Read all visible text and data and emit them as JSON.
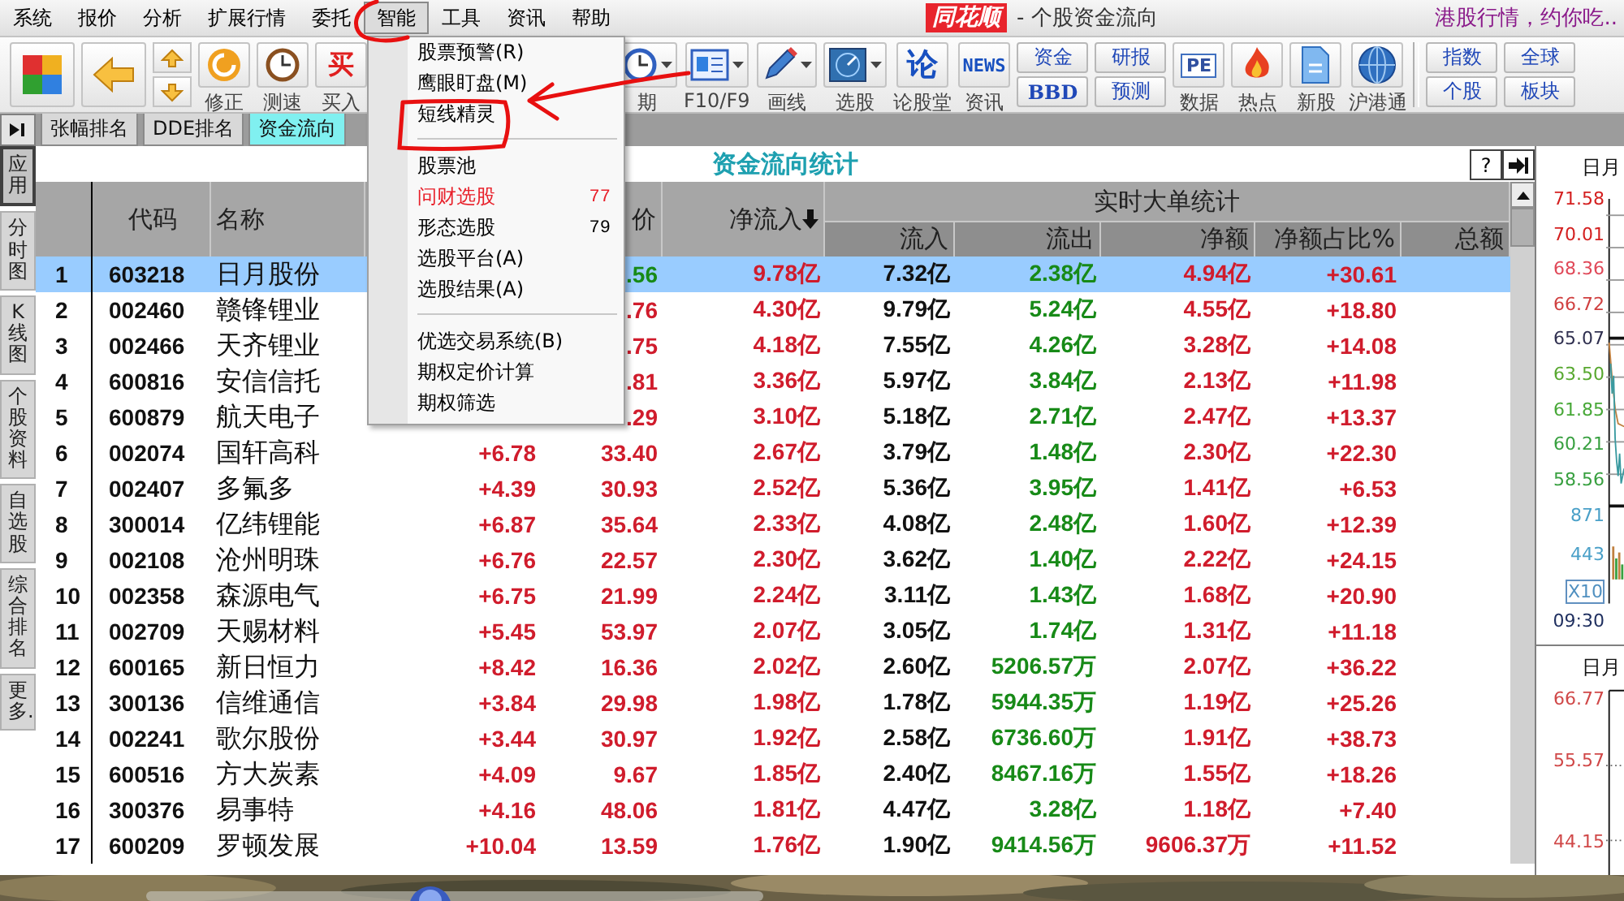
{
  "menu_bar": {
    "items": [
      {
        "label": "系统",
        "selected": false
      },
      {
        "label": "报价",
        "selected": false
      },
      {
        "label": "分析",
        "selected": false
      },
      {
        "label": "扩展行情",
        "selected": false
      },
      {
        "label": "委托",
        "selected": false
      },
      {
        "label": "智能",
        "selected": true
      },
      {
        "label": "工具",
        "selected": false
      },
      {
        "label": "资讯",
        "selected": false
      },
      {
        "label": "帮助",
        "selected": false
      }
    ],
    "logo": "同花顺",
    "title": "- 个股资金流向",
    "promo": "港股行情，约你吃.."
  },
  "toolbar": {
    "items": [
      {
        "kind": "large"
      },
      {
        "kind": "large"
      },
      {
        "kind": "updown"
      },
      {
        "kind": "icon",
        "label": "修正"
      },
      {
        "kind": "icon",
        "label": "测速"
      },
      {
        "kind": "icon",
        "label": "买入",
        "glyph": "买"
      },
      {
        "kind": "icon",
        "label": "期",
        "dropdown": true
      },
      {
        "kind": "icon",
        "label": "F10/F9",
        "dropdown": true
      },
      {
        "kind": "icon",
        "label": "画线",
        "dropdown": true
      },
      {
        "kind": "icon",
        "label": "选股",
        "dropdown": true
      },
      {
        "kind": "icon",
        "label": "论股堂",
        "glyph": "论"
      },
      {
        "kind": "icon",
        "label": "资讯",
        "glyph": "NEWS"
      },
      {
        "kind": "pair",
        "top": "资金",
        "bottom": "BBD"
      },
      {
        "kind": "pair",
        "top": "研报",
        "bottom": "预测"
      },
      {
        "kind": "icon",
        "label": "数据",
        "glyph": "PE"
      },
      {
        "kind": "icon",
        "label": "热点"
      },
      {
        "kind": "icon",
        "label": "新股"
      },
      {
        "kind": "icon",
        "label": "沪港通"
      },
      {
        "kind": "separator"
      },
      {
        "kind": "pair",
        "top": "指数",
        "bottom": "个股"
      },
      {
        "kind": "pair",
        "top": "全球",
        "bottom": "板块"
      }
    ]
  },
  "tabs": [
    {
      "label": "张幅排名",
      "selected": false
    },
    {
      "label": "DDE排名",
      "selected": false
    },
    {
      "label": "资金流向",
      "selected": true
    }
  ],
  "sidebar": {
    "items": [
      {
        "label": "应用",
        "selected": true
      },
      {
        "label": "分时图",
        "selected": false
      },
      {
        "label": "K线图",
        "selected": false
      },
      {
        "label": "个股资料",
        "selected": false
      },
      {
        "label": "自选股",
        "selected": false
      },
      {
        "label": "综合排名",
        "selected": false
      },
      {
        "label": "更多..",
        "selected": false
      }
    ]
  },
  "table": {
    "title": "资金流向统计",
    "help": "?",
    "columns": [
      {
        "label": "代码"
      },
      {
        "label": "名称"
      },
      {
        "label": "价"
      },
      {
        "label": "净流入",
        "sorted": true
      }
    ],
    "group": {
      "label": "实时大单统计",
      "columns": [
        "流入",
        "流出",
        "净额",
        "净额占比%",
        "总额"
      ]
    },
    "rows": [
      {
        "no": "1",
        "code": "603218",
        "name": "日月股份",
        "price": ".56",
        "price_down": true,
        "net_inflow": "9.78亿",
        "inflow": "7.32亿",
        "outflow": "2.38亿",
        "net_amount": "4.94亿",
        "net_ratio": "+30.61",
        "selected": true
      },
      {
        "no": "2",
        "code": "002460",
        "name": "赣锋锂业",
        "price": ".76",
        "price_down": false,
        "net_inflow": "4.30亿",
        "inflow": "9.79亿",
        "outflow": "5.24亿",
        "net_amount": "4.55亿",
        "net_ratio": "+18.80",
        "selected": false
      },
      {
        "no": "3",
        "code": "002466",
        "name": "天齐锂业",
        "price": ".75",
        "price_down": false,
        "net_inflow": "4.18亿",
        "inflow": "7.55亿",
        "outflow": "4.26亿",
        "net_amount": "3.28亿",
        "net_ratio": "+14.08",
        "selected": false
      },
      {
        "no": "4",
        "code": "600816",
        "name": "安信信托",
        "price": ".81",
        "price_down": false,
        "net_inflow": "3.36亿",
        "inflow": "5.97亿",
        "outflow": "3.84亿",
        "net_amount": "2.13亿",
        "net_ratio": "+11.98",
        "selected": false
      },
      {
        "no": "5",
        "code": "600879",
        "name": "航天电子",
        "price": ".29",
        "price_down": false,
        "net_inflow": "3.10亿",
        "inflow": "5.18亿",
        "outflow": "2.71亿",
        "net_amount": "2.47亿",
        "net_ratio": "+13.37",
        "selected": false
      },
      {
        "no": "6",
        "code": "002074",
        "name": "国轩高科",
        "change": "+6.78",
        "price": "33.40",
        "price_down": false,
        "net_inflow": "2.67亿",
        "inflow": "3.79亿",
        "outflow": "1.48亿",
        "net_amount": "2.30亿",
        "net_ratio": "+22.30",
        "selected": false
      },
      {
        "no": "7",
        "code": "002407",
        "name": "多氟多",
        "change": "+4.39",
        "price": "30.93",
        "price_down": false,
        "net_inflow": "2.52亿",
        "inflow": "5.36亿",
        "outflow": "3.95亿",
        "net_amount": "1.41亿",
        "net_ratio": "+6.53",
        "selected": false
      },
      {
        "no": "8",
        "code": "300014",
        "name": "亿纬锂能",
        "change": "+6.87",
        "price": "35.64",
        "price_down": false,
        "net_inflow": "2.33亿",
        "inflow": "4.08亿",
        "outflow": "2.48亿",
        "net_amount": "1.60亿",
        "net_ratio": "+12.39",
        "selected": false
      },
      {
        "no": "9",
        "code": "002108",
        "name": "沧州明珠",
        "change": "+6.76",
        "price": "22.57",
        "price_down": false,
        "net_inflow": "2.30亿",
        "inflow": "3.62亿",
        "outflow": "1.40亿",
        "net_amount": "2.22亿",
        "net_ratio": "+24.15",
        "selected": false
      },
      {
        "no": "10",
        "code": "002358",
        "name": "森源电气",
        "change": "+6.75",
        "price": "21.99",
        "price_down": false,
        "net_inflow": "2.24亿",
        "inflow": "3.11亿",
        "outflow": "1.43亿",
        "net_amount": "1.68亿",
        "net_ratio": "+20.90",
        "selected": false
      },
      {
        "no": "11",
        "code": "002709",
        "name": "天赐材料",
        "change": "+5.45",
        "price": "53.97",
        "price_down": false,
        "net_inflow": "2.07亿",
        "inflow": "3.05亿",
        "outflow": "1.74亿",
        "net_amount": "1.31亿",
        "net_ratio": "+11.18",
        "selected": false
      },
      {
        "no": "12",
        "code": "600165",
        "name": "新日恒力",
        "change": "+8.42",
        "price": "16.36",
        "price_down": false,
        "net_inflow": "2.02亿",
        "inflow": "2.60亿",
        "outflow": "5206.57万",
        "net_amount": "2.07亿",
        "net_ratio": "+36.22",
        "selected": false
      },
      {
        "no": "13",
        "code": "300136",
        "name": "信维通信",
        "change": "+3.84",
        "price": "29.98",
        "price_down": false,
        "net_inflow": "1.98亿",
        "inflow": "1.78亿",
        "outflow": "5944.35万",
        "net_amount": "1.19亿",
        "net_ratio": "+25.26",
        "selected": false
      },
      {
        "no": "14",
        "code": "002241",
        "name": "歌尔股份",
        "change": "+3.44",
        "price": "30.97",
        "price_down": false,
        "net_inflow": "1.92亿",
        "inflow": "2.58亿",
        "outflow": "6736.60万",
        "net_amount": "1.91亿",
        "net_ratio": "+38.73",
        "selected": false
      },
      {
        "no": "15",
        "code": "600516",
        "name": "方大炭素",
        "change": "+4.09",
        "price": "9.67",
        "price_down": false,
        "net_inflow": "1.85亿",
        "inflow": "2.40亿",
        "outflow": "8467.16万",
        "net_amount": "1.55亿",
        "net_ratio": "+18.26",
        "selected": false
      },
      {
        "no": "16",
        "code": "300376",
        "name": "易事特",
        "change": "+4.16",
        "price": "48.06",
        "price_down": false,
        "net_inflow": "1.81亿",
        "inflow": "4.47亿",
        "outflow": "3.28亿",
        "net_amount": "1.18亿",
        "net_ratio": "+7.40",
        "selected": false
      },
      {
        "no": "17",
        "code": "600209",
        "name": "罗顿发展",
        "change": "+10.04",
        "price": "13.59",
        "price_down": false,
        "net_inflow": "1.76亿",
        "inflow": "1.90亿",
        "outflow": "9414.56万",
        "net_amount": "9606.37万",
        "net_ratio": "+11.52",
        "selected": false
      }
    ]
  },
  "menu": {
    "items": [
      {
        "kind": "item",
        "label": "股票预警(R)",
        "color": "#000000"
      },
      {
        "kind": "item",
        "label": "鹰眼盯盘(M)",
        "color": "#000000"
      },
      {
        "kind": "item",
        "label": "短线精灵",
        "color": "#000000"
      },
      {
        "kind": "divider"
      },
      {
        "kind": "item",
        "label": "股票池",
        "color": "#000000"
      },
      {
        "kind": "item",
        "label": "问财选股",
        "count": "77",
        "color": "#e8202a"
      },
      {
        "kind": "item",
        "label": "形态选股",
        "count": "79",
        "color": "#000000"
      },
      {
        "kind": "item",
        "label": "选股平台(A)",
        "color": "#000000"
      },
      {
        "kind": "item",
        "label": "选股结果(A)",
        "color": "#000000"
      },
      {
        "kind": "divider"
      },
      {
        "kind": "item",
        "label": "优选交易系统(B)",
        "color": "#000000"
      },
      {
        "kind": "item",
        "label": "期权定价计算",
        "color": "#000000"
      },
      {
        "kind": "item",
        "label": "期权筛选",
        "color": "#000000"
      }
    ]
  },
  "chart_panel": {
    "title": "日月",
    "price_labels": [
      {
        "text": "71.58",
        "color": "#d42020"
      },
      {
        "text": "70.01",
        "color": "#d42020"
      },
      {
        "text": "68.36",
        "color": "#e04858"
      },
      {
        "text": "66.72",
        "color": "#d04040"
      },
      {
        "text": "65.07",
        "color": "#303050"
      },
      {
        "text": "63.50",
        "color": "#58a830"
      },
      {
        "text": "61.85",
        "color": "#48a838"
      },
      {
        "text": "60.21",
        "color": "#38a040"
      },
      {
        "text": "58.56",
        "color": "#38a040"
      }
    ],
    "volume_labels": [
      "871",
      "443"
    ],
    "scale": "X10",
    "time": "09:30",
    "lower_title": "日月",
    "lower_labels": [
      "66.77",
      "55.57",
      "44.15"
    ]
  }
}
